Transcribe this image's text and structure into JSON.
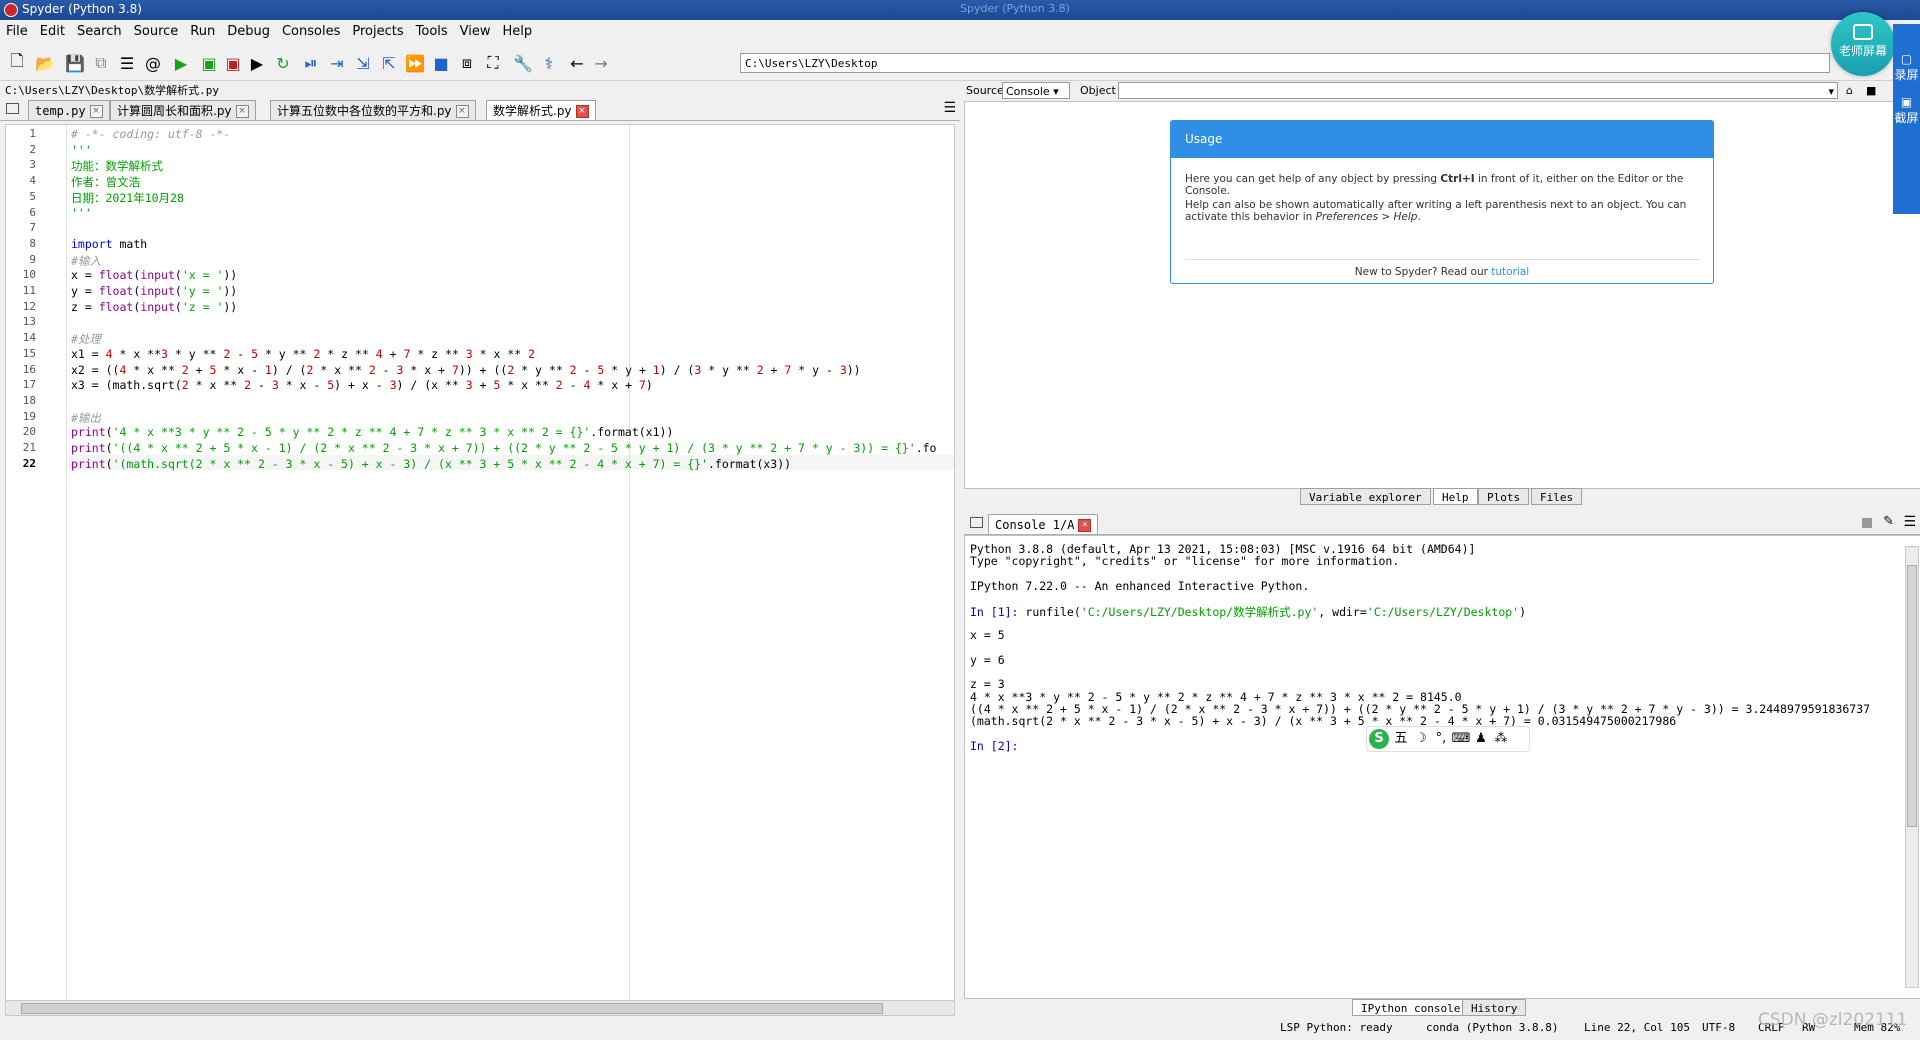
{
  "window": {
    "title": "Spyder (Python 3.8)",
    "ghost_title": "Spyder (Python 3.8)"
  },
  "menu": [
    "File",
    "Edit",
    "Search",
    "Source",
    "Run",
    "Debug",
    "Consoles",
    "Projects",
    "Tools",
    "View",
    "Help"
  ],
  "toolbar": {
    "path": "C:\\Users\\LZY\\Desktop"
  },
  "editor": {
    "file_path": "C:\\Users\\LZY\\Desktop\\数学解析式.py",
    "tabs": [
      {
        "label": "temp.py",
        "active": false
      },
      {
        "label": "计算圆周长和面积.py",
        "active": false
      },
      {
        "label": "计算五位数中各位数的平方和.py",
        "active": false
      },
      {
        "label": "数学解析式.py",
        "active": true
      }
    ],
    "current_line": 22,
    "lines": [
      "# -*- coding: utf-8 -*-",
      "'''",
      "功能：数学解析式",
      "作者：曾文浩",
      "日期：2021年10月28",
      "'''",
      "",
      "import math",
      "#输入",
      "x = float(input('x = '))",
      "y = float(input('y = '))",
      "z = float(input('z = '))",
      "",
      "#处理",
      "x1 = 4 * x **3 * y ** 2 - 5 * y ** 2 * z ** 4 + 7 * z ** 3 * x ** 2",
      "x2 = ((4 * x ** 2 + 5 * x - 1) / (2 * x ** 2 - 3 * x + 7)) + ((2 * y ** 2 - 5 * y + 1) / (3 * y ** 2 + 7 * y - 3))",
      "x3 = (math.sqrt(2 * x ** 2 - 3 * x - 5) + x - 3) / (x ** 3 + 5 * x ** 2 - 4 * x + 7)",
      "",
      "#输出",
      "print('4 * x **3 * y ** 2 - 5 * y ** 2 * z ** 4 + 7 * z ** 3 * x ** 2 = {}'.format(x1))",
      "print('((4 * x ** 2 + 5 * x - 1) / (2 * x ** 2 - 3 * x + 7)) + ((2 * y ** 2 - 5 * y + 1) / (3 * y ** 2 + 7 * y - 3)) = {}'.fo",
      "print('(math.sqrt(2 * x ** 2 - 3 * x - 5) + x - 3) / (x ** 3 + 5 * x ** 2 - 4 * x + 7) = {}'.format(x3))"
    ]
  },
  "help": {
    "source_label": "Source",
    "source_value": "Console",
    "object_label": "Object",
    "usage_title": "Usage",
    "usage_p1_a": "Here you can get help of any object by pressing ",
    "usage_p1_key": "Ctrl+I",
    "usage_p1_b": " in front of it, either on the Editor or the Console.",
    "usage_p2_a": "Help can also be shown automatically after writing a left parenthesis next to an object. You can activate this behavior in ",
    "usage_p2_link": "Preferences > Help",
    "usage_p2_b": ".",
    "footer_text": "New to Spyder? Read our ",
    "footer_link": "tutorial",
    "tabs": [
      "Variable explorer",
      "Help",
      "Plots",
      "Files"
    ]
  },
  "console": {
    "tab_label": "Console 1/A",
    "lines": [
      "Python 3.8.8 (default, Apr 13 2021, 15:08:03) [MSC v.1916 64 bit (AMD64)]",
      "Type \"copyright\", \"credits\" or \"license\" for more information.",
      "",
      "IPython 7.22.0 -- An enhanced Interactive Python.",
      "",
      "In [1]: runfile('C:/Users/LZY/Desktop/数学解析式.py', wdir='C:/Users/LZY/Desktop')",
      "",
      "x = 5",
      "",
      "y = 6",
      "",
      "z = 3",
      "4 * x **3 * y ** 2 - 5 * y ** 2 * z ** 4 + 7 * z ** 3 * x ** 2 = 8145.0",
      "((4 * x ** 2 + 5 * x - 1) / (2 * x ** 2 - 3 * x + 7)) + ((2 * y ** 2 - 5 * y + 1) / (3 * y ** 2 + 7 * y - 3)) = 3.2448979591836737",
      "(math.sqrt(2 * x ** 2 - 3 * x - 5) + x - 3) / (x ** 3 + 5 * x ** 2 - 4 * x + 7) = 0.031549475000217986",
      "",
      "In [2]:"
    ],
    "bottom_tabs": [
      "IPython console",
      "History"
    ],
    "ime": [
      "S",
      "五",
      "☽",
      "°,",
      "⌨",
      "♟",
      "⁂"
    ]
  },
  "status": {
    "lsp": "LSP Python: ready",
    "conda": "conda (Python 3.8.8)",
    "position": "Line 22, Col 105",
    "encoding": "UTF-8",
    "eol": "CRLF",
    "rw": "RW",
    "mem": "Mem 82%"
  },
  "watermark": "CSDN @zl202111",
  "overlay": {
    "float_label": "老师屏幕",
    "side_items": [
      "录屏",
      "截屏"
    ]
  }
}
